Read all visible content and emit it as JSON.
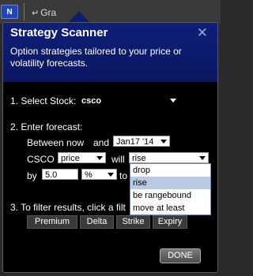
{
  "topbar": {
    "n_button": "N",
    "gr_label": "Gra"
  },
  "popup": {
    "title": "Strategy Scanner",
    "description": "Option strategies tailored to your price or volatility forecasts.",
    "step1": {
      "label": "1. Select Stock:",
      "stock": "csco"
    },
    "step2": {
      "label": "2. Enter forecast:",
      "between": "Between now",
      "and": "and",
      "date": "Jan17 '14",
      "ticker": "CSCO",
      "metric": "price",
      "will": "will",
      "direction": "rise",
      "by": "by",
      "amount": "5.0",
      "unit": "%",
      "to": "to"
    },
    "direction_options": [
      "drop",
      "rise",
      "be rangebound",
      "move at least"
    ],
    "step3": {
      "label": "3. To filter results, click a filt"
    },
    "filters": [
      "Premium",
      "Delta",
      "Strike",
      "Expiry"
    ],
    "done": "DONE"
  }
}
